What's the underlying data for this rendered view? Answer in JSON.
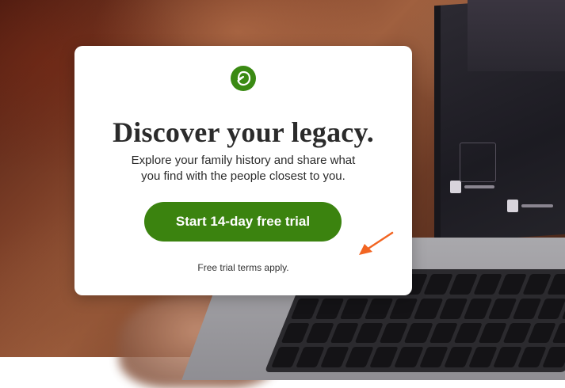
{
  "modal": {
    "headline": "Discover your legacy.",
    "subtext_line1": "Explore your family history and share what",
    "subtext_line2": "you find with the people closest to you.",
    "cta_label": "Start 14-day free trial",
    "terms": "Free trial terms apply."
  },
  "icons": {
    "logo": "leaf-icon",
    "annotation": "arrow-icon"
  },
  "colors": {
    "brand_green": "#3b830f",
    "logo_green": "#3a8a13",
    "annotation_arrow": "#f26522",
    "card_background": "#ffffff",
    "text": "#2b2b2b"
  }
}
